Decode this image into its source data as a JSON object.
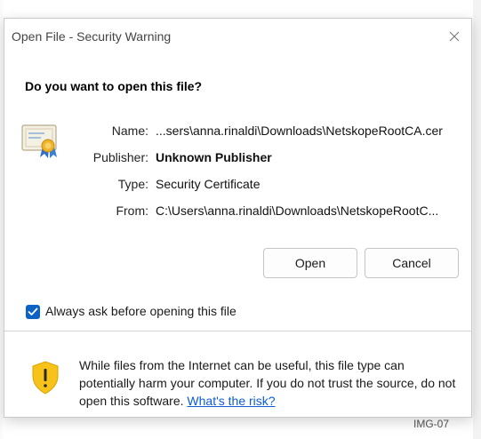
{
  "window": {
    "title": "Open File - Security Warning",
    "close_glyph": "✕"
  },
  "heading": "Do you want to open this file?",
  "fields": [
    {
      "label": "Name:",
      "value": "...sers\\anna.rinaldi\\Downloads\\NetskopeRootCA.cer"
    },
    {
      "label": "Publisher:",
      "value": "Unknown Publisher"
    },
    {
      "label": "Type:",
      "value": "Security Certificate"
    },
    {
      "label": "From:",
      "value": "C:\\Users\\anna.rinaldi\\Downloads\\NetskopeRootC..."
    }
  ],
  "buttons": {
    "open_label": "Open",
    "cancel_label": "Cancel"
  },
  "ask_checkbox": {
    "label": "Always ask before opening this file",
    "checked": true
  },
  "warning": {
    "text": "While files from the Internet can be useful, this file type can potentially harm your computer. If you do not trust the source, do not open this software.",
    "link": "What's the risk?"
  },
  "background": {
    "bottom_text": "IMG-07"
  },
  "colors": {
    "accent": "#0b62c7",
    "link": "#0b5cd5",
    "warning_yellow": "#f7c21a"
  },
  "icons": {
    "certificate": "certificate-icon",
    "shield": "shield-warning-icon",
    "close": "close-icon",
    "check": "checkmark-icon"
  }
}
